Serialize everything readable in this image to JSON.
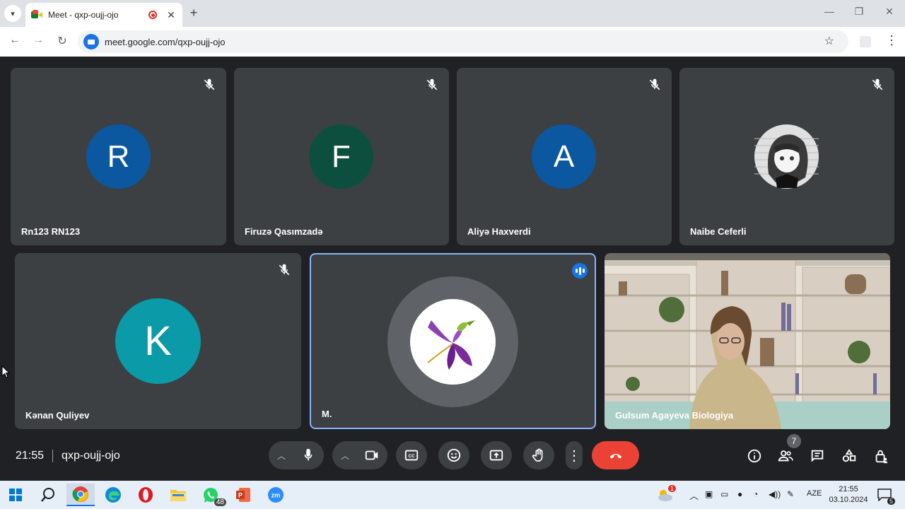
{
  "browser": {
    "tab_title": "Meet - qxp-oujj-ojo",
    "url": "meet.google.com/qxp-oujj-ojo",
    "new_tab_symbol": "+",
    "close_symbol": "✕"
  },
  "participants": [
    {
      "name": "Rn123 RN123",
      "initial": "R",
      "avatar_color": "#0b57a0",
      "muted": true
    },
    {
      "name": "Firuzə Qasımzadə",
      "initial": "F",
      "avatar_color": "#0d4f3f",
      "muted": true
    },
    {
      "name": "Aliyə Haxverdi",
      "initial": "A",
      "avatar_color": "#0b57a0",
      "muted": true
    },
    {
      "name": "Naibe Ceferli",
      "initial": "",
      "avatar_color": "#e8e8e8",
      "muted": true
    },
    {
      "name": "Kənan Quliyev",
      "initial": "K",
      "avatar_color": "#0a9aa8",
      "muted": true
    },
    {
      "name": "M.",
      "initial": "",
      "avatar_color": "#ffffff",
      "muted": false,
      "speaking": true
    },
    {
      "name": "Gulsum Agayeva Biologiya",
      "initial": "",
      "avatar_color": "",
      "muted": false,
      "video": true
    }
  ],
  "meeting": {
    "time": "21:55",
    "code": "qxp-oujj-ojo",
    "participant_count": "7"
  },
  "taskbar": {
    "whatsapp_badge": "48",
    "weather_badge": "1",
    "language": "AZE",
    "time": "21:55",
    "date": "03.10.2024",
    "notification_count": "5"
  },
  "colors": {
    "stage_bg": "#202124",
    "tile_bg": "#3c4043",
    "accent": "#1a73e8",
    "end_call": "#ea4335"
  }
}
